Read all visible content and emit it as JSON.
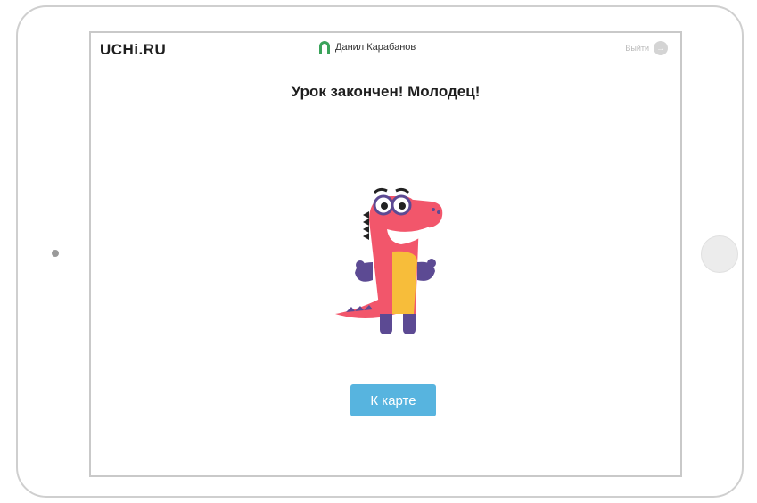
{
  "header": {
    "logo": "UCHi.RU",
    "user_name": "Данил Карабанов",
    "logout_label": "Выйти"
  },
  "main": {
    "title": "Урок закончен! Молодец!",
    "map_button_label": "К карте"
  },
  "icons": {
    "user": "user-headphones-icon",
    "logout": "logout-icon",
    "mascot": "dinosaur-mascot"
  },
  "colors": {
    "button": "#57b4df",
    "user_icon": "#3aa35a",
    "mascot_body": "#f2566b",
    "mascot_belly": "#f7bd3a",
    "mascot_dark": "#5c4a93"
  }
}
